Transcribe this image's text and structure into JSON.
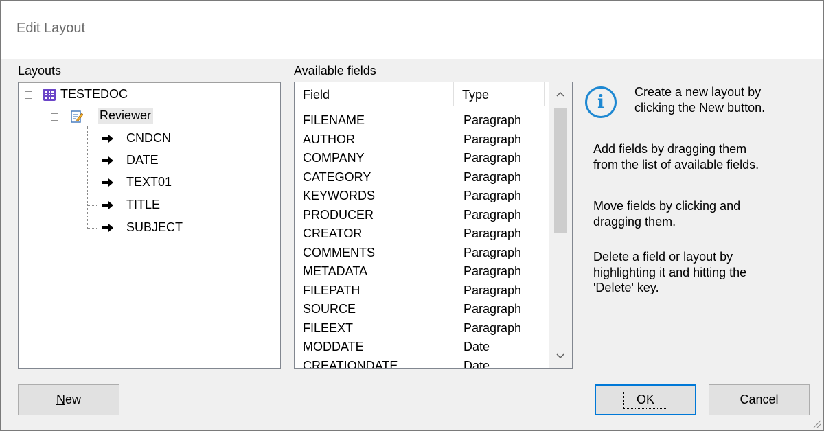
{
  "window": {
    "title": "Edit Layout"
  },
  "layouts_panel": {
    "label": "Layouts",
    "tree": {
      "root": {
        "label": "TESTEDOC"
      },
      "layout": {
        "label": "Reviewer"
      },
      "fields": [
        "CNDCN",
        "DATE",
        "TEXT01",
        "TITLE",
        "SUBJECT"
      ]
    }
  },
  "fields_panel": {
    "label": "Available fields",
    "columns": {
      "field": "Field",
      "type": "Type"
    },
    "rows": [
      {
        "field": "FILENAME",
        "type": "Paragraph"
      },
      {
        "field": "AUTHOR",
        "type": "Paragraph"
      },
      {
        "field": "COMPANY",
        "type": "Paragraph"
      },
      {
        "field": "CATEGORY",
        "type": "Paragraph"
      },
      {
        "field": "KEYWORDS",
        "type": "Paragraph"
      },
      {
        "field": "PRODUCER",
        "type": "Paragraph"
      },
      {
        "field": "CREATOR",
        "type": "Paragraph"
      },
      {
        "field": "COMMENTS",
        "type": "Paragraph"
      },
      {
        "field": "METADATA",
        "type": "Paragraph"
      },
      {
        "field": "FILEPATH",
        "type": "Paragraph"
      },
      {
        "field": "SOURCE",
        "type": "Paragraph"
      },
      {
        "field": "FILEEXT",
        "type": "Paragraph"
      },
      {
        "field": "MODDATE",
        "type": "Date"
      },
      {
        "field": "CREATIONDATE",
        "type": "Date"
      }
    ]
  },
  "info": {
    "line1": "Create a new layout by",
    "line2": "clicking the New button.",
    "p2_line1": "Add fields by dragging them",
    "p2_line2": "from the list of available fields.",
    "p3_line1": "Move fields by clicking and",
    "p3_line2": "dragging them.",
    "p4_line1": "Delete a field or layout by",
    "p4_line2": "highlighting it and hitting the",
    "p4_line3": "'Delete' key."
  },
  "buttons": {
    "new_mnemonic": "N",
    "new_rest": "ew",
    "ok": "OK",
    "cancel": "Cancel"
  },
  "colors": {
    "accent": "#0078d7",
    "info_icon": "#1e88d2",
    "grid_icon": "#6b45c8"
  }
}
